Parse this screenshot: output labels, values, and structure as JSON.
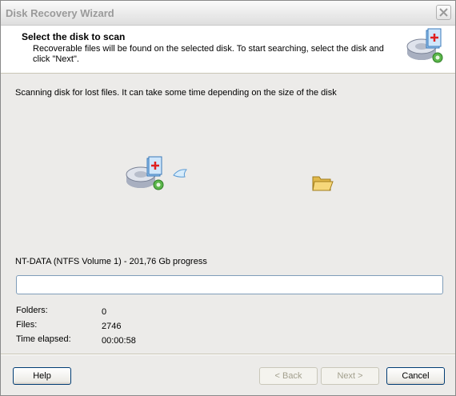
{
  "window": {
    "title": "Disk Recovery Wizard"
  },
  "header": {
    "title": "Select the disk to scan",
    "description": "Recoverable files will be found on the selected disk. To start searching, select the disk and click \"Next\"."
  },
  "scan": {
    "message": "Scanning disk for lost files. It can take some time depending on the size of the disk",
    "progress_label": "NT-DATA (NTFS Volume 1) - 201,76 Gb progress",
    "progress_fraction": 0
  },
  "stats": {
    "folders_label": "Folders:",
    "folders_value": "0",
    "files_label": "Files:",
    "files_value": "2746",
    "time_label": "Time elapsed:",
    "time_value": "00:00:58"
  },
  "buttons": {
    "help": "Help",
    "back": "< Back",
    "next": "Next >",
    "cancel": "Cancel"
  },
  "icons": {
    "close": "close-icon",
    "header_disk": "disk-wizard-icon",
    "scan_disk": "disk-wizard-icon",
    "flying_file": "file-icon",
    "folder": "folder-icon"
  }
}
